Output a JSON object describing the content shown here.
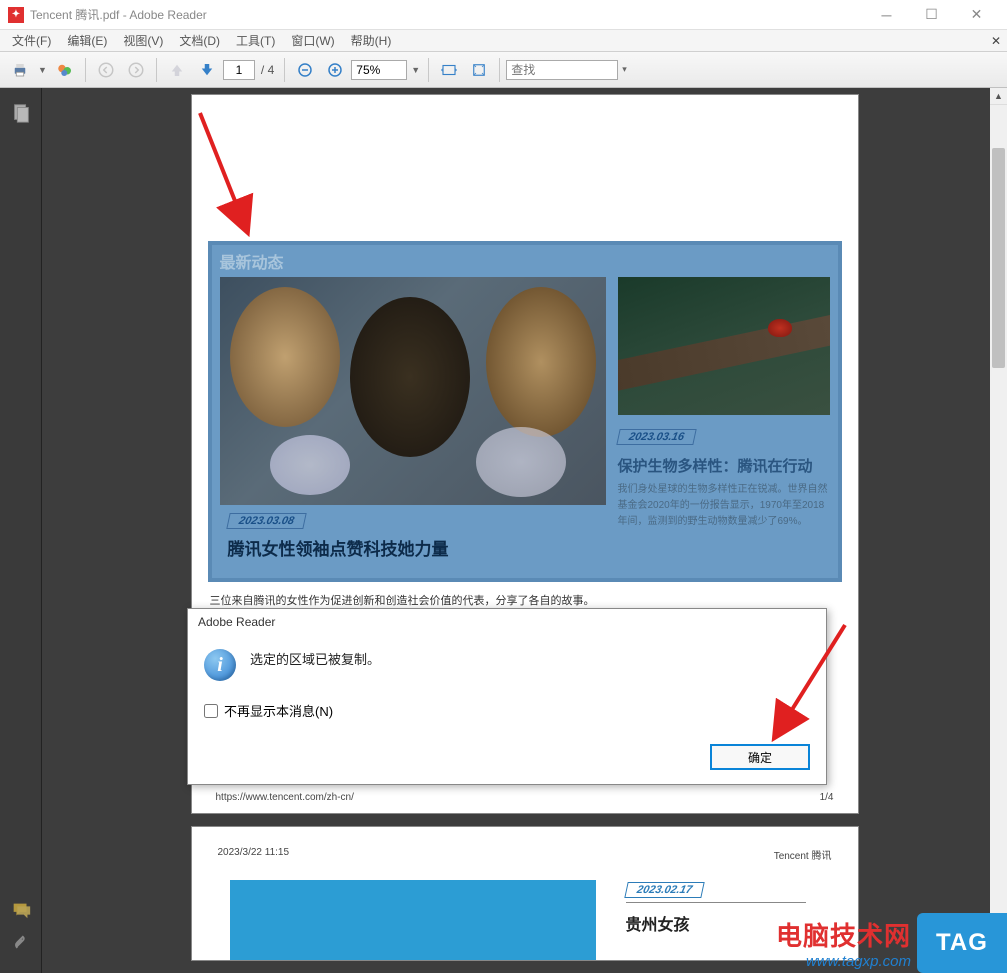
{
  "window": {
    "title": "Tencent 腾讯.pdf - Adobe Reader"
  },
  "menu": {
    "items": [
      "文件(F)",
      "编辑(E)",
      "视图(V)",
      "文档(D)",
      "工具(T)",
      "窗口(W)",
      "帮助(H)"
    ]
  },
  "toolbar": {
    "page_current": "1",
    "page_total": "/ 4",
    "zoom": "75%",
    "search_placeholder": "查找"
  },
  "doc": {
    "news_section": "最新动态",
    "article1": {
      "date": "2023.03.08",
      "title": "腾讯女性领袖点赞科技她力量",
      "subtitle": "三位来自腾讯的女性作为促进创新和创造社会价值的代表，分享了各自的故事。"
    },
    "article2": {
      "date": "2023.03.16",
      "title": "保护生物多样性：腾讯在行动",
      "desc": "我们身处星球的生物多样性正在锐减。世界自然基金会2020年的一份报告显示，1970年至2018年间，监测到的野生动物数量减少了69%。"
    },
    "footer_url": "https://www.tencent.com/zh-cn/",
    "footer_page": "1/4"
  },
  "page2": {
    "left_header": "2023/3/22 11:15",
    "right_header": "Tencent 腾讯",
    "date": "2023.02.17",
    "title": "贵州女孩"
  },
  "dialog": {
    "title": "Adobe Reader",
    "message": "选定的区域已被复制。",
    "checkbox": "不再显示本消息(N)",
    "ok": "确定"
  },
  "watermark": {
    "cn": "电脑技术网",
    "url": "www.tagxp.com",
    "tag": "TAG"
  }
}
